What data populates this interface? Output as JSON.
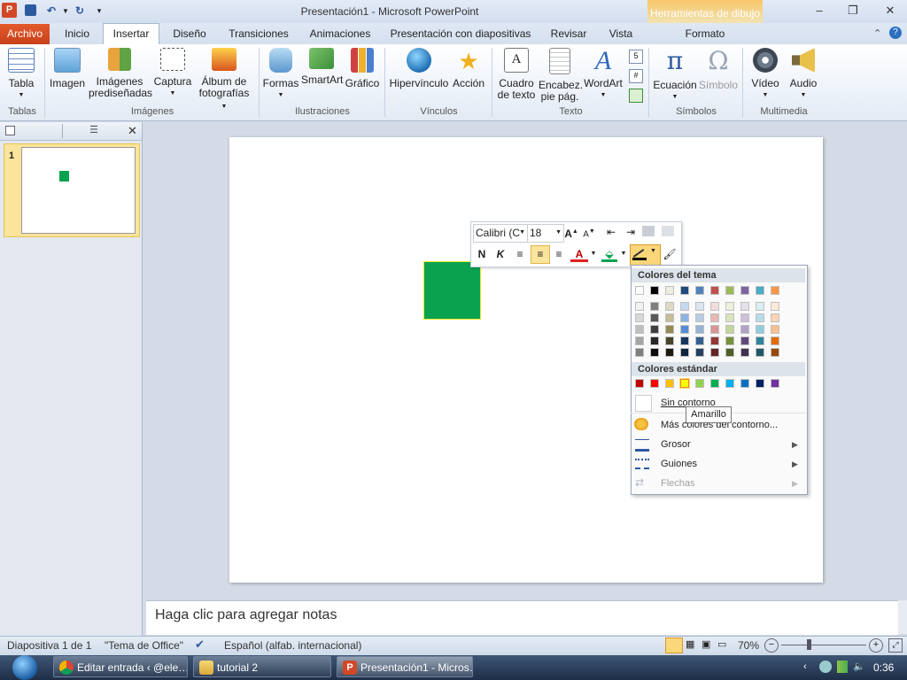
{
  "window": {
    "title": "Presentación1 - Microsoft PowerPoint",
    "contextual_tab_group": "Herramientas de dibujo"
  },
  "tabs": [
    "Archivo",
    "Inicio",
    "Insertar",
    "Diseño",
    "Transiciones",
    "Animaciones",
    "Presentación con diapositivas",
    "Revisar",
    "Vista",
    "Formato"
  ],
  "ribbon": {
    "tabla": "Tabla",
    "imagen": "Imagen",
    "imagenes_pred": [
      "Imágenes",
      "prediseñadas"
    ],
    "captura": "Captura",
    "album": [
      "Álbum de",
      "fotografías"
    ],
    "formas": "Formas",
    "smartart": "SmartArt",
    "grafico": "Gráfico",
    "hipervinculo": "Hipervínculo",
    "accion": "Acción",
    "cuadro": [
      "Cuadro",
      "de texto"
    ],
    "encabez": [
      "Encabez.",
      "pie pág."
    ],
    "wordart": "WordArt",
    "ecuacion": "Ecuación",
    "simbolo": "Símbolo",
    "video": "Vídeo",
    "audio": "Audio",
    "groups": [
      "Tablas",
      "Imágenes",
      "Ilustraciones",
      "Vínculos",
      "Texto",
      "Símbolos",
      "Multimedia"
    ]
  },
  "thumbnail": {
    "number": "1"
  },
  "minitoolbar": {
    "font": "Calibri (C",
    "size": "18"
  },
  "menu": {
    "theme_header": "Colores del tema",
    "standard_header": "Colores estándar",
    "no_outline": "Sin contorno",
    "more_colors": "Más colores del contorno...",
    "weight": "Grosor",
    "dashes": "Guiones",
    "arrows": "Flechas",
    "tooltip": "Amarillo"
  },
  "theme_colors": {
    "top": [
      "#ffffff",
      "#000000",
      "#eeece1",
      "#1f497d",
      "#4f81bd",
      "#c0504d",
      "#9bbb59",
      "#8064a2",
      "#4bacc6",
      "#f79646"
    ],
    "shades": [
      [
        "#f2f2f2",
        "#7f7f7f",
        "#ddd9c3",
        "#c6d9f0",
        "#dbe5f1",
        "#f2dcdb",
        "#ebf1dd",
        "#e5e0ec",
        "#dbeef3",
        "#fdeada"
      ],
      [
        "#d8d8d8",
        "#595959",
        "#c4bd97",
        "#8db3e2",
        "#b8cce4",
        "#e5b9b7",
        "#d7e3bc",
        "#ccc1d9",
        "#b7dde8",
        "#fbd5b5"
      ],
      [
        "#bfbfbf",
        "#3f3f3f",
        "#938953",
        "#548dd4",
        "#95b3d7",
        "#d99694",
        "#c3d69b",
        "#b2a2c7",
        "#92cddc",
        "#fac08f"
      ],
      [
        "#a5a5a5",
        "#262626",
        "#494429",
        "#17365d",
        "#366092",
        "#953734",
        "#76923c",
        "#5f497a",
        "#31859b",
        "#e36c09"
      ],
      [
        "#7f7f7f",
        "#0c0c0c",
        "#1d1b10",
        "#0f243e",
        "#244061",
        "#632423",
        "#4f6128",
        "#3f3151",
        "#205867",
        "#974806"
      ]
    ]
  },
  "standard_colors": [
    "#c00000",
    "#ff0000",
    "#ffc000",
    "#ffff00",
    "#92d050",
    "#00b050",
    "#00b0f0",
    "#0070c0",
    "#002060",
    "#7030a0"
  ],
  "notes": {
    "placeholder": "Haga clic para agregar notas"
  },
  "status": {
    "slide": "Diapositiva 1 de 1",
    "theme": "\"Tema de Office\"",
    "language": "Español (alfab. internacional)",
    "zoom": "70%"
  },
  "taskbar": {
    "items": [
      "Editar entrada ‹ @ele…",
      "tutorial 2",
      "Presentación1 - Micros…"
    ],
    "clock": "0:36"
  }
}
